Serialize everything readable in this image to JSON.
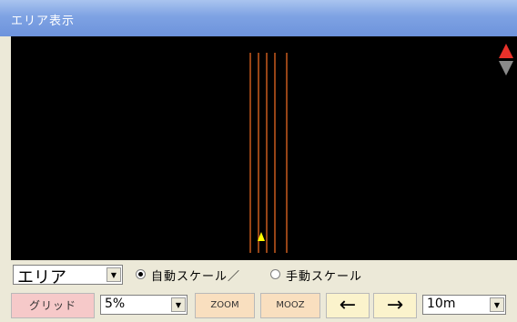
{
  "window": {
    "title": "エリア表示"
  },
  "canvas": {
    "background": "#000000",
    "line_color": "#c85a1e",
    "marker_color": "#ffff00"
  },
  "scroll_arrows": {
    "up_color": "#e8312a",
    "down_color": "#8a8a8a"
  },
  "area_select": {
    "value": "エリア"
  },
  "scale_mode": {
    "auto_label": "自動スケール／",
    "manual_label": "手動スケール",
    "selected": "auto"
  },
  "toolbar": {
    "grid_label": "グリッド",
    "percent_value": "5%",
    "zoom_in_label": "ZOOM",
    "zoom_out_label": "MOOZ",
    "left_label": "←",
    "right_label": "→",
    "distance_value": "10m"
  },
  "colors": {
    "grid_button": "#f6c9c9",
    "zoom_buttons": "#f9dfbf",
    "arrow_buttons": "#fbf3cc"
  }
}
